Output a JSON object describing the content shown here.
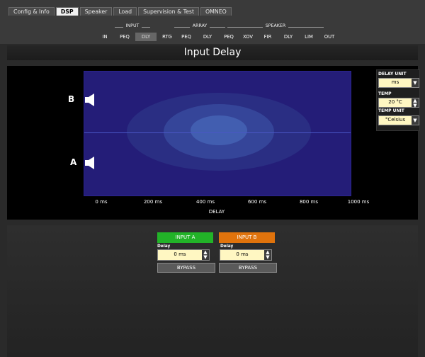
{
  "tabs": [
    "Config & Info",
    "DSP",
    "Speaker",
    "Load",
    "Supervision & Test",
    "OMNEO"
  ],
  "active_tab": "DSP",
  "groups": {
    "input": "INPUT",
    "array": "ARRAY",
    "speaker": "SPEAKER"
  },
  "nav": [
    "IN",
    "PEQ",
    "DLY",
    "RTG",
    "PEQ",
    "DLY",
    "PEQ",
    "XOV",
    "FIR",
    "DLY",
    "LIM",
    "OUT"
  ],
  "active_nav": "DLY",
  "title": "Input Delay",
  "plot": {
    "labels": {
      "b": "B",
      "a": "A"
    },
    "xaxis": {
      "ticks": [
        "0 ms",
        "200 ms",
        "400 ms",
        "600 ms",
        "800 ms",
        "1000 ms"
      ],
      "label": "DELAY"
    }
  },
  "right_panel": {
    "delay_unit_label": "DELAY UNIT",
    "delay_unit_value": "ms",
    "temp_label": "TEMP",
    "temp_value": "20 °C",
    "temp_unit_label": "TEMP UNIT",
    "temp_unit_value": "°Celsius"
  },
  "inputs": [
    {
      "label": "INPUT A",
      "delay_label": "Delay",
      "delay_value": "0 ms",
      "bypass": "BYPASS",
      "color": "#22b328"
    },
    {
      "label": "INPUT B",
      "delay_label": "Delay",
      "delay_value": "0 ms",
      "bypass": "BYPASS",
      "color": "#e0730c"
    }
  ]
}
